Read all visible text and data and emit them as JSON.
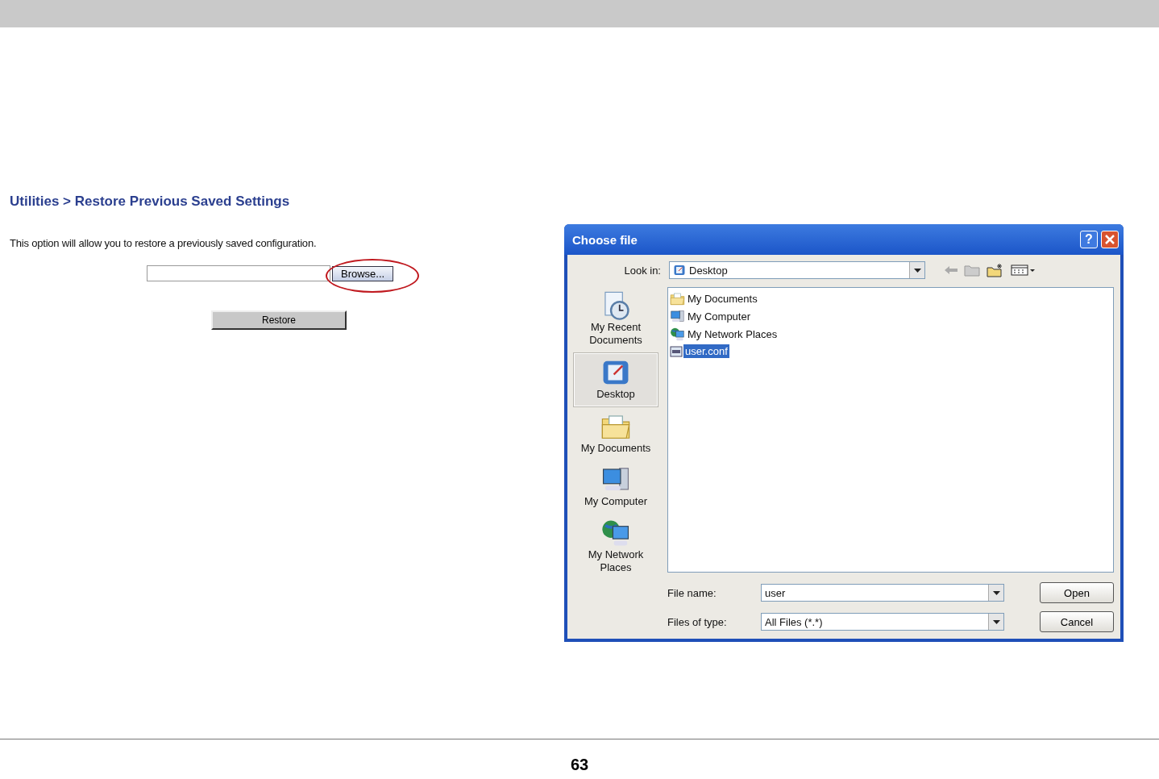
{
  "router_page": {
    "breadcrumb": "Utilities > Restore Previous Saved Settings",
    "description": "This option will allow you to restore a previously saved configuration.",
    "browse_button": {
      "label": "Browse...",
      "circled": true
    },
    "restore_button": "Restore"
  },
  "dialog": {
    "title": "Choose file",
    "help_button": "?",
    "look_in_label": "Look in:",
    "look_in_value": "Desktop",
    "places": [
      {
        "label": "My Recent Documents",
        "kind": "recent",
        "selected": false
      },
      {
        "label": "Desktop",
        "kind": "desktop",
        "selected": true
      },
      {
        "label": "My Documents",
        "kind": "documents",
        "selected": false
      },
      {
        "label": "My Computer",
        "kind": "computer",
        "selected": false
      },
      {
        "label": "My Network Places",
        "kind": "network",
        "selected": false
      }
    ],
    "files": [
      {
        "name": "My Documents",
        "kind": "documents",
        "selected": false
      },
      {
        "name": "My Computer",
        "kind": "computer",
        "selected": false
      },
      {
        "name": "My Network Places",
        "kind": "network",
        "selected": false
      },
      {
        "name": "user.conf",
        "kind": "file",
        "selected": true
      }
    ],
    "file_name_label": "File name:",
    "file_name_value": "user",
    "file_type_label": "Files of type:",
    "file_type_value": "All Files (*.*)",
    "buttons": [
      "Open",
      "Cancel"
    ]
  },
  "page_number": "63"
}
